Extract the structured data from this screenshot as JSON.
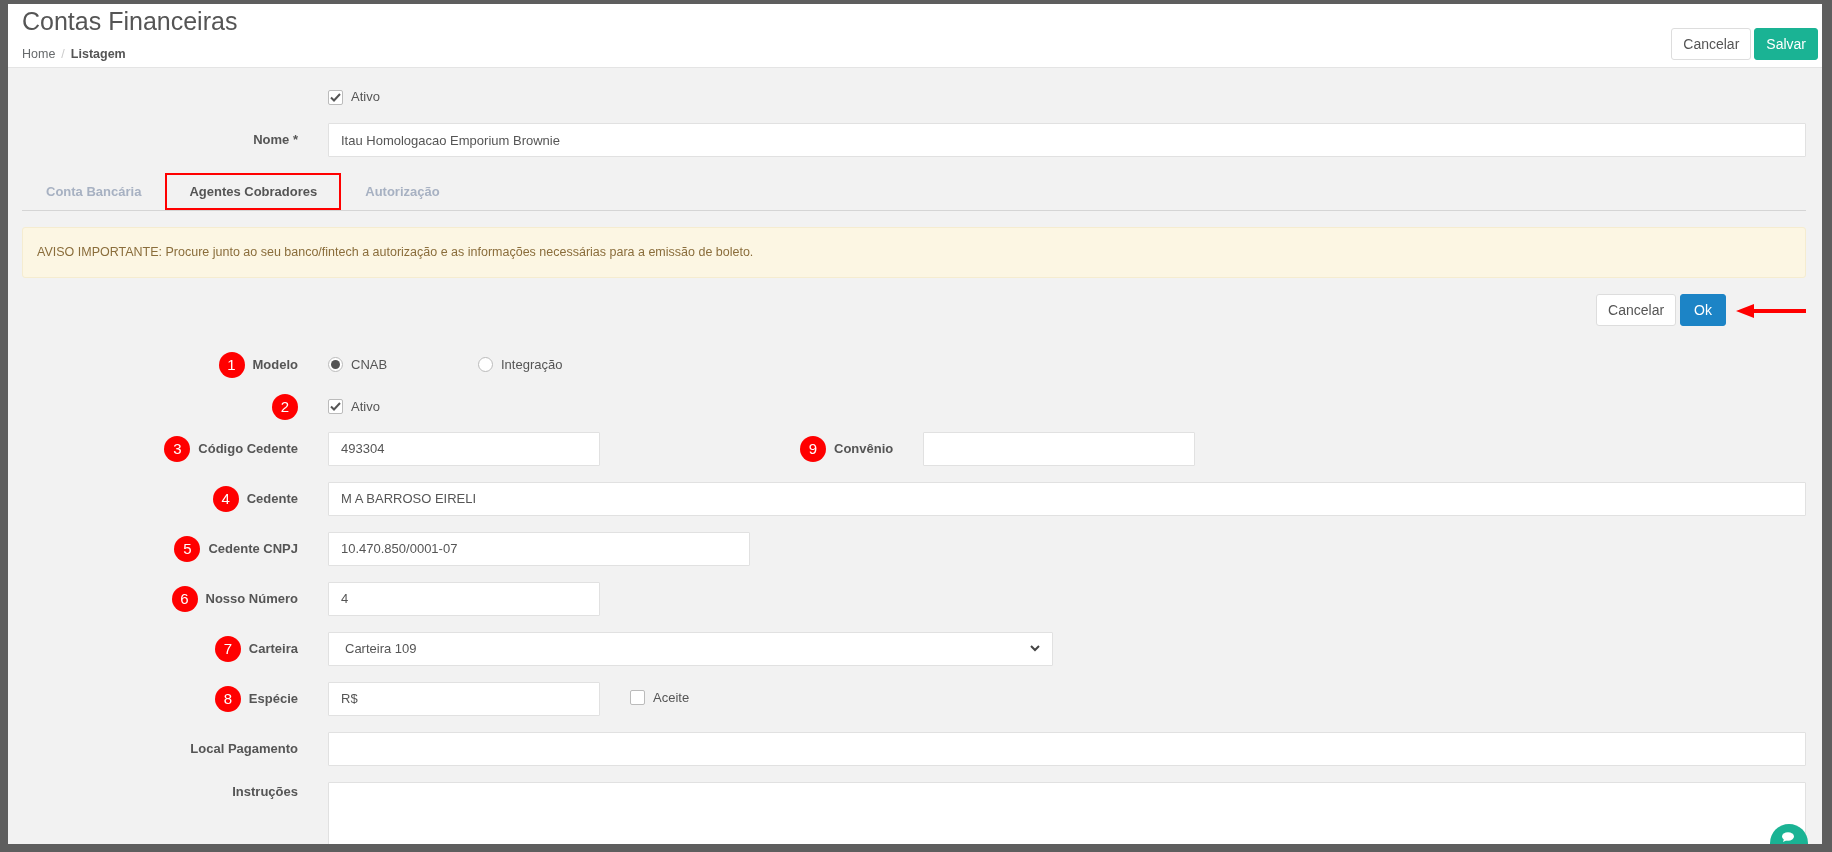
{
  "header": {
    "title": "Contas Financeiras",
    "breadcrumb": [
      {
        "label": "Home",
        "current": false
      },
      {
        "label": "Listagem",
        "current": true,
        "separator": "/"
      }
    ],
    "buttons": [
      {
        "label": "Cancelar",
        "kind": "default"
      },
      {
        "label": "Salvar",
        "kind": "success"
      }
    ]
  },
  "account": {
    "active": {
      "label": "Ativo",
      "checked": true
    },
    "name": {
      "label": "Nome *",
      "value": "Itau Homologacao Emporium Brownie"
    }
  },
  "tabs": [
    {
      "label": "Conta Bancária",
      "selected": false,
      "highlighted": false
    },
    {
      "label": "Agentes Cobradores",
      "selected": true,
      "highlighted": true
    },
    {
      "label": "Autorização",
      "selected": false,
      "highlighted": false
    }
  ],
  "alert": "AVISO IMPORTANTE: Procure junto ao seu banco/fintech a autorização e as informações necessárias para a emissão de boleto.",
  "panel_buttons": [
    {
      "label": "Cancelar",
      "kind": "default"
    },
    {
      "label": "Ok",
      "kind": "primary"
    }
  ],
  "fields": [
    {
      "kind": "radio",
      "marker": "1",
      "label": "Modelo",
      "options": [
        {
          "label": "CNAB",
          "selected": true
        },
        {
          "label": "Integração",
          "selected": false
        }
      ]
    },
    {
      "kind": "checkbox",
      "marker": "2",
      "label": "Ativo",
      "checked": true
    },
    {
      "kind": "text_pair",
      "marker": "3",
      "label": "Código Cedente",
      "value": "493304",
      "second": {
        "marker": "9",
        "label": "Convênio"
      }
    },
    {
      "kind": "text",
      "marker": "4",
      "label": "Cedente",
      "value": "M A BARROSO EIRELI"
    },
    {
      "kind": "medium_text",
      "marker": "5",
      "label": "Cedente CNPJ",
      "value": "10.470.850/0001-07"
    },
    {
      "kind": "short_text",
      "marker": "6",
      "label": "Nosso Número",
      "value": "4"
    },
    {
      "kind": "select",
      "marker": "7",
      "label": "Carteira",
      "value": "Carteira 109"
    },
    {
      "kind": "short_text_check",
      "marker": "8",
      "label": "Espécie",
      "value": "R$",
      "check": {
        "label": "Aceite",
        "checked": false
      }
    },
    {
      "kind": "text",
      "label": "Local Pagamento"
    },
    {
      "kind": "textarea",
      "label": "Instruções"
    }
  ]
}
